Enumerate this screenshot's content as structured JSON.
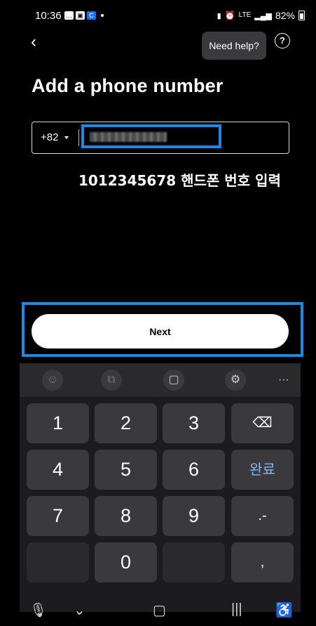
{
  "status": {
    "time": "10:36",
    "network": "LTE",
    "battery": "82%"
  },
  "header": {
    "help_tooltip": "Need help?",
    "help_icon": "?"
  },
  "title": "Add a phone number",
  "phone": {
    "country_code": "+82",
    "value": ""
  },
  "annotation": "1012345678 핸드폰 번호 입력",
  "next_label": "Next",
  "keyboard": {
    "toolbar": [
      "☺",
      "⧉",
      "▢",
      "⚙",
      "···"
    ],
    "keys": [
      "1",
      "2",
      "3",
      "⌫",
      "4",
      "5",
      "6",
      "완료",
      "7",
      "8",
      "9",
      ".-",
      "",
      "0",
      "",
      ","
    ]
  }
}
